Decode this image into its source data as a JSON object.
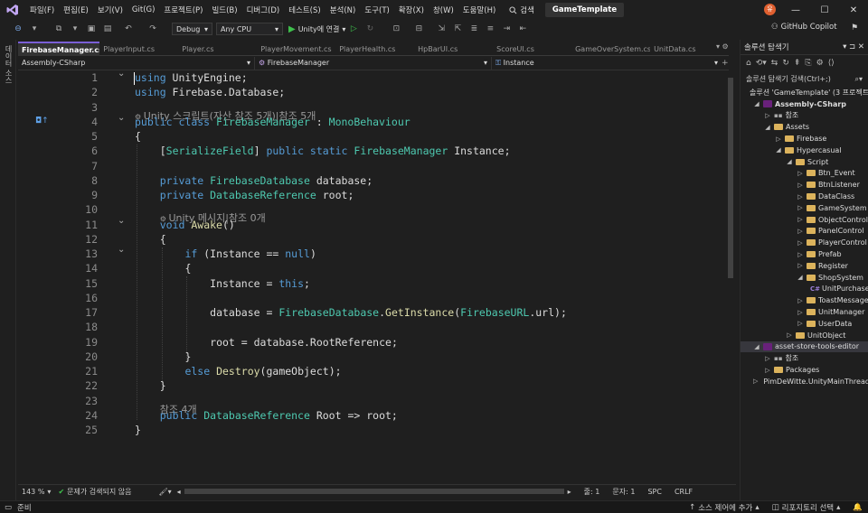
{
  "menubar": {
    "items": [
      "파일(F)",
      "편집(E)",
      "보기(V)",
      "Git(G)",
      "프로젝트(P)",
      "빌드(B)",
      "디버그(D)",
      "테스트(S)",
      "분석(N)",
      "도구(T)",
      "확장(X)",
      "창(W)",
      "도움말(H)"
    ],
    "search_label": "검색",
    "solution_name": "GameTemplate",
    "avatar": "유"
  },
  "toolbar": {
    "config": "Debug",
    "platform": "Any CPU",
    "run_label": "Unity에 연결",
    "copilot": "GitHub Copilot"
  },
  "left_tab": {
    "label": "데이터 소스"
  },
  "tabs": [
    {
      "label": "FirebaseManager.cs",
      "active": true
    },
    {
      "label": "PlayerInput.cs"
    },
    {
      "label": "Player.cs"
    },
    {
      "label": "PlayerMovement.cs"
    },
    {
      "label": "PlayerHealth.cs"
    },
    {
      "label": "HpBarUI.cs"
    },
    {
      "label": "ScoreUI.cs"
    },
    {
      "label": "GameOverSystem.cs"
    },
    {
      "label": "UnitData.cs"
    }
  ],
  "nav": {
    "project": "Assembly-CSharp",
    "type": "FirebaseManager",
    "member": "Instance"
  },
  "code": {
    "line_numbers": [
      "1",
      "2",
      "3",
      "4",
      "5",
      "6",
      "7",
      "8",
      "9",
      "10",
      "11",
      "12",
      "13",
      "14",
      "15",
      "16",
      "17",
      "18",
      "19",
      "20",
      "21",
      "22",
      "23",
      "24",
      "25"
    ],
    "lens_unity_script": "Unity 스크립트(자산 참조 5개)|참조 5개",
    "lens_unity_message": "Unity 메시지|참조 0개",
    "lens_refs": "참조 4개",
    "l1_kw": "using",
    "l1_rest": " UnityEngine;",
    "l2_kw": "using",
    "l2_rest": " Firebase.Database;",
    "l4_kw1": "public",
    "l4_kw2": " class ",
    "l4_name": "FirebaseManager",
    "l4_colon": " : ",
    "l4_base": "MonoBehaviour",
    "l5": "{",
    "l6_b1": "[",
    "l6_attr": "SerializeField",
    "l6_b2": "] ",
    "l6_kw": "public static",
    "l6_sp": " ",
    "l6_type": "FirebaseManager",
    "l6_rest": " Instance;",
    "l8_kw": "private",
    "l8_sp": " ",
    "l8_type": "FirebaseDatabase",
    "l8_rest": " database;",
    "l9_kw": "private",
    "l9_sp": " ",
    "l9_type": "DatabaseReference",
    "l9_rest": " root;",
    "l11_kw": "void",
    "l11_sp": " ",
    "l11_mt": "Awake",
    "l11_rest": "()",
    "l12": "{",
    "l13_kw": "if",
    "l13_mid": " (Instance == ",
    "l13_null": "null",
    "l13_end": ")",
    "l14": "{",
    "l15_a": "Instance = ",
    "l15_kw": "this",
    "l15_b": ";",
    "l17_a": "database = ",
    "l17_ty": "FirebaseDatabase",
    "l17_dot": ".",
    "l17_mt": "GetInstance",
    "l17_p": "(",
    "l17_ty2": "FirebaseURL",
    "l17_rest": ".url);",
    "l19": "root = database.RootReference;",
    "l20": "}",
    "l21_kw": "else",
    "l21_sp": " ",
    "l21_mt": "Destroy",
    "l21_rest": "(gameObject);",
    "l22": "}",
    "l24_kw": "public",
    "l24_sp": " ",
    "l24_type": "DatabaseReference",
    "l24_rest": " Root => root;",
    "l25": "}"
  },
  "editor_status": {
    "zoom": "143 %",
    "issues": "문제가 검색되지 않음",
    "line": "줄: 1",
    "char": "문자: 1",
    "ws": "SPC",
    "eol": "CRLF"
  },
  "statusbar": {
    "ready": "준비",
    "source_control": "소스 제어에 추가",
    "repo": "리포지토리 선택"
  },
  "solution_explorer": {
    "title": "솔루션 탐색기",
    "search_placeholder": "솔루션 탐색기 검색(Ctrl+;)",
    "solution": "솔루션 'GameTemplate' (3 프로젝트)",
    "items": [
      {
        "label": "Assembly-CSharp",
        "kind": "project",
        "bold": true
      },
      {
        "label": "참조",
        "kind": "ref"
      },
      {
        "label": "Assets",
        "kind": "folder"
      },
      {
        "label": "Firebase",
        "kind": "folder"
      },
      {
        "label": "Hypercasual",
        "kind": "folder"
      },
      {
        "label": "Script",
        "kind": "folder"
      },
      {
        "label": "Btn_Event",
        "kind": "folder"
      },
      {
        "label": "BtnListener",
        "kind": "folder"
      },
      {
        "label": "DataClass",
        "kind": "folder"
      },
      {
        "label": "GameSystem",
        "kind": "folder"
      },
      {
        "label": "ObjectControl",
        "kind": "folder"
      },
      {
        "label": "PanelControl",
        "kind": "folder"
      },
      {
        "label": "PlayerControl",
        "kind": "folder"
      },
      {
        "label": "Prefab",
        "kind": "folder"
      },
      {
        "label": "Register",
        "kind": "folder"
      },
      {
        "label": "ShopSystem",
        "kind": "folder"
      },
      {
        "label": "UnitPurchase",
        "kind": "cs"
      },
      {
        "label": "ToastMessage",
        "kind": "folder"
      },
      {
        "label": "UnitManager",
        "kind": "folder"
      },
      {
        "label": "UserData",
        "kind": "folder"
      },
      {
        "label": "UnitObject",
        "kind": "folder"
      },
      {
        "label": "asset-store-tools-editor",
        "kind": "project"
      },
      {
        "label": "참조",
        "kind": "ref"
      },
      {
        "label": "Packages",
        "kind": "folder"
      },
      {
        "label": "PimDeWitte.UnityMainThread",
        "kind": "project"
      }
    ]
  },
  "colors": {
    "keyword": "#569cd6",
    "type": "#4ec9b0",
    "method": "#dcdcaa",
    "accent": "#7a5fd6"
  }
}
